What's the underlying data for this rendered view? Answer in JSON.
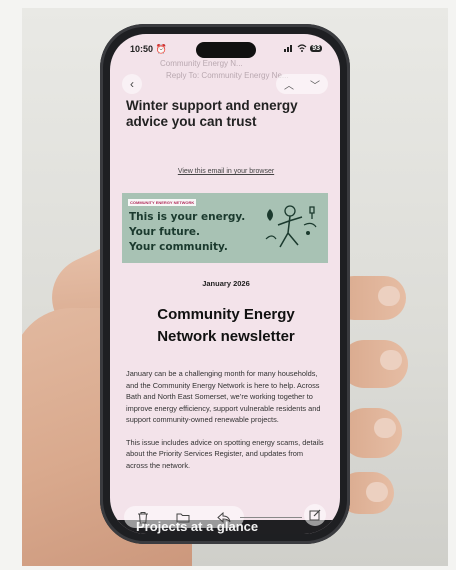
{
  "status_bar": {
    "time": "10:50",
    "battery": "93"
  },
  "ghost_header": {
    "from": "Community Energy N...",
    "reply_to": "Reply To: Community Energy Ne..."
  },
  "email": {
    "title": "Winter support and energy advice you can trust",
    "view_in_browser": "View this email in your browser",
    "banner": {
      "tag": "COMMUNITY ENERGY NETWORK",
      "line1": "This is your energy.",
      "line2": "Your future.",
      "line3": "Your community."
    },
    "date": "January 2026",
    "newsletter_title": "Community Energy Network newsletter",
    "paragraph1": "January can be a challenging month for many households, and the Community Energy Network is here to help. Across Bath and North East Somerset, we’re working together to improve energy efficiency, support vulnerable residents and support community-owned renewable projects.",
    "paragraph2": "This issue includes advice on spotting energy scams, details about the Priority Services Register, and updates from across the network.",
    "next_section": "Projects at a glance"
  },
  "colors": {
    "banner_bg": "#a8c2b4",
    "banner_text": "#1b3a2e",
    "screen_bg": "#f3e3ea",
    "phone_frame": "#1e1f22"
  },
  "icons": [
    "back-chevron-icon",
    "up-chevron-icon",
    "down-chevron-icon",
    "trash-icon",
    "folder-icon",
    "reply-icon",
    "compose-icon",
    "signal-icon",
    "wifi-icon",
    "alarm-icon"
  ]
}
